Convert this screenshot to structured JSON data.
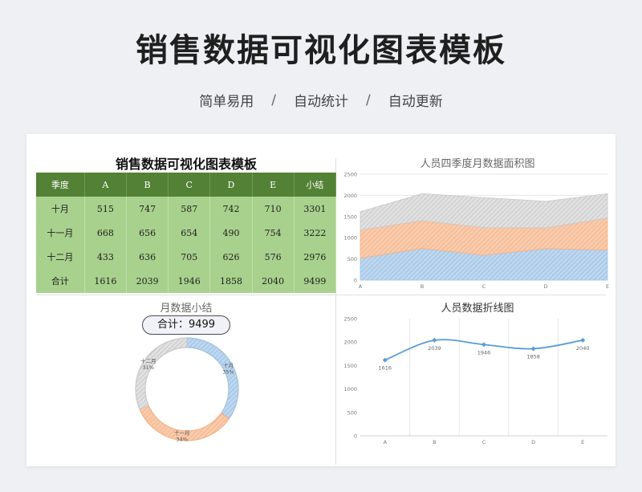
{
  "header": {
    "title": "销售数据可视化图表模板",
    "tags": [
      "简单易用",
      "自动统计",
      "自动更新"
    ],
    "separator": "/"
  },
  "table": {
    "title": "销售数据可视化图表模板",
    "columns": [
      "季度",
      "A",
      "B",
      "C",
      "D",
      "E",
      "小结"
    ],
    "rows": [
      [
        "十月",
        "515",
        "747",
        "587",
        "742",
        "710",
        "3301"
      ],
      [
        "十一月",
        "668",
        "656",
        "654",
        "490",
        "754",
        "3222"
      ],
      [
        "十二月",
        "433",
        "636",
        "705",
        "626",
        "576",
        "2976"
      ],
      [
        "合计",
        "1616",
        "2039",
        "1946",
        "1858",
        "2040",
        "9499"
      ]
    ]
  },
  "area_chart_title": "人员四季度月数据面积图",
  "donut_chart_title": "月数据小结",
  "total_label": "合计：9499",
  "line_chart_title": "人员数据折线图",
  "chart_data": [
    {
      "type": "area",
      "title": "人员四季度月数据面积图",
      "categories": [
        "A",
        "B",
        "C",
        "D",
        "E"
      ],
      "stacked": true,
      "series": [
        {
          "values": [
            515,
            747,
            587,
            742,
            710
          ],
          "color": "#9dc3e6"
        },
        {
          "values": [
            668,
            656,
            654,
            490,
            754
          ],
          "color": "#f4b183"
        },
        {
          "values": [
            433,
            636,
            705,
            626,
            576
          ],
          "color": "#c9c9c9"
        }
      ],
      "ylim": [
        0,
        2500
      ],
      "yticks": [
        "0",
        "500",
        "1000",
        "1500",
        "2000",
        "2500"
      ]
    },
    {
      "type": "pie",
      "title": "月数据小结",
      "donut": true,
      "slices": [
        {
          "name": "十月",
          "value": 3301,
          "label": "35%",
          "color": "#9dc3e6"
        },
        {
          "name": "十一月",
          "value": 3222,
          "label": "34%",
          "color": "#f4b183"
        },
        {
          "name": "十二月",
          "value": 2976,
          "label": "31%",
          "color": "#c9c9c9"
        }
      ]
    },
    {
      "type": "line",
      "title": "人员数据折线图",
      "categories": [
        "A",
        "B",
        "C",
        "D",
        "E"
      ],
      "values": [
        1616,
        2039,
        1946,
        1858,
        2040
      ],
      "data_labels": [
        "1616",
        "2039",
        "1946",
        "1858",
        "2040"
      ],
      "color": "#5b9bd5",
      "ylim": [
        0,
        2500
      ],
      "yticks": [
        "0",
        "500",
        "1000",
        "1500",
        "2000",
        "2500"
      ],
      "smooth": true
    }
  ]
}
